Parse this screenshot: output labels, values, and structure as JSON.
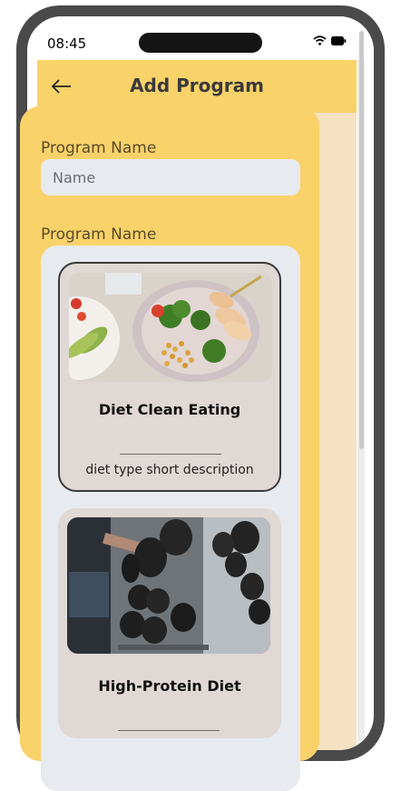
{
  "status_bar": {
    "time": "08:45"
  },
  "app_bar": {
    "title": "Add Program"
  },
  "form": {
    "program_name_label": "Program Name",
    "name_placeholder": "Name",
    "name_value": "",
    "program_type_label": "Program Name"
  },
  "programs": [
    {
      "title": "Diet Clean Eating",
      "description": "diet type short description",
      "selected": true
    },
    {
      "title": "High-Protein Diet",
      "description": "",
      "selected": false
    }
  ],
  "colors": {
    "accent": "#fad26a",
    "background": "#f6e1c2",
    "card": "#e0d8d4",
    "input": "#e7eaee"
  }
}
